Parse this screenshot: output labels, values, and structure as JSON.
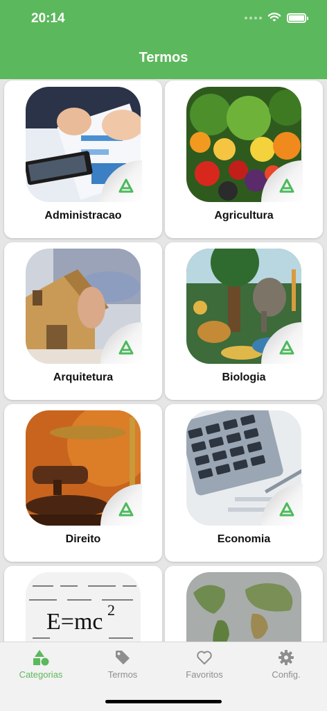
{
  "status": {
    "time": "20:14"
  },
  "header": {
    "title": "Termos"
  },
  "categories": [
    {
      "label": "Administracao",
      "image": "business-documents-photo"
    },
    {
      "label": "Agricultura",
      "image": "vegetables-photo"
    },
    {
      "label": "Arquitetura",
      "image": "house-model-photo"
    },
    {
      "label": "Biologia",
      "image": "wildlife-photo"
    },
    {
      "label": "Direito",
      "image": "gavel-scale-photo"
    },
    {
      "label": "Economia",
      "image": "calculator-photo"
    },
    {
      "label": "",
      "image": "formulas-photo"
    },
    {
      "label": "",
      "image": "world-map-photo"
    }
  ],
  "tabbar": {
    "items": [
      {
        "label": "Categorias",
        "icon": "shapes-icon",
        "active": true
      },
      {
        "label": "Termos",
        "icon": "tag-icon",
        "active": false
      },
      {
        "label": "Favoritos",
        "icon": "heart-icon",
        "active": false
      },
      {
        "label": "Config.",
        "icon": "gear-icon",
        "active": false
      }
    ]
  },
  "colors": {
    "primary": "#5cb85c",
    "background": "#e6e6e6",
    "tab_inactive": "#8e8e8e"
  }
}
